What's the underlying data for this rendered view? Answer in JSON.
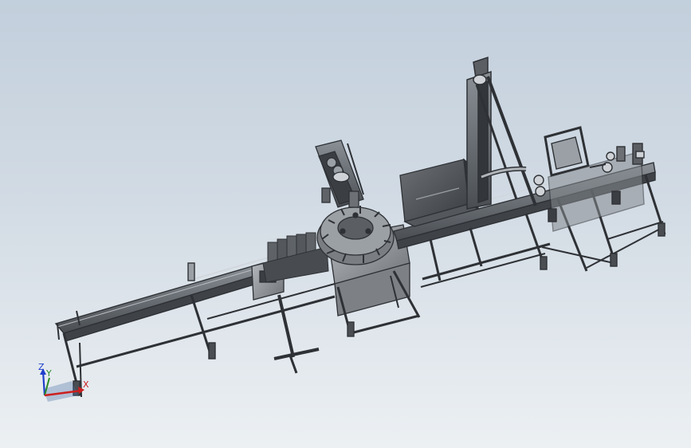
{
  "viewport": {
    "background_top": "#c2cfdc",
    "background_bottom": "#ecf0f3",
    "model_color": "#5d6165",
    "model_dark": "#2e3135",
    "model_light": "#9aa0a6"
  },
  "triad": {
    "x_label": "X",
    "y_label": "Y",
    "z_label": "Z",
    "x_color": "#cc1f1f",
    "y_color": "#2a8a2a",
    "z_color": "#1f3fcc"
  }
}
